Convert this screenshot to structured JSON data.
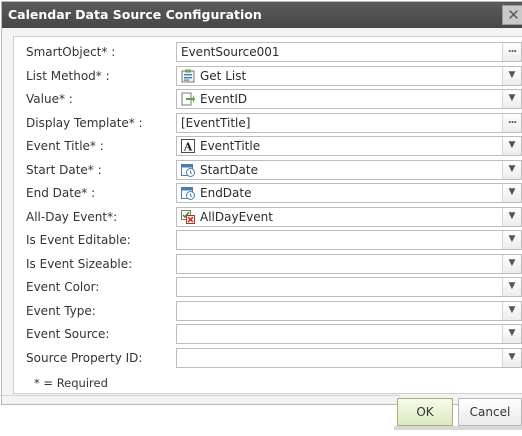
{
  "dialog": {
    "title": "Calendar Data Source Configuration",
    "close_glyph": "✕"
  },
  "fields": [
    {
      "label": "SmartObject* :",
      "value": "EventSource001",
      "icon": "",
      "button": "ellipsis"
    },
    {
      "label": "List Method* :",
      "value": "Get List",
      "icon": "list-method-icon",
      "button": "dropdown"
    },
    {
      "label": "Value* :",
      "value": "EventID",
      "icon": "id-property-icon",
      "button": "dropdown"
    },
    {
      "label": "Display Template* :",
      "value": "[EventTitle]",
      "icon": "",
      "button": "ellipsis"
    },
    {
      "label": "Event Title* :",
      "value": "EventTitle",
      "icon": "text-property-icon",
      "button": "dropdown"
    },
    {
      "label": "Start Date* :",
      "value": "StartDate",
      "icon": "datetime-property-icon",
      "button": "dropdown"
    },
    {
      "label": "End Date* :",
      "value": "EndDate",
      "icon": "datetime-property-icon",
      "button": "dropdown"
    },
    {
      "label": "All-Day Event*:",
      "value": "AllDayEvent",
      "icon": "boolean-property-icon",
      "button": "dropdown"
    },
    {
      "label": "Is Event Editable:",
      "value": "",
      "icon": "",
      "button": "dropdown"
    },
    {
      "label": "Is Event Sizeable:",
      "value": "",
      "icon": "",
      "button": "dropdown"
    },
    {
      "label": "Event Color:",
      "value": "",
      "icon": "",
      "button": "dropdown"
    },
    {
      "label": "Event Type:",
      "value": "",
      "icon": "",
      "button": "dropdown"
    },
    {
      "label": "Event Source:",
      "value": "",
      "icon": "",
      "button": "dropdown"
    },
    {
      "label": "Source Property ID:",
      "value": "",
      "icon": "",
      "button": "dropdown"
    }
  ],
  "required_note": "* = Required",
  "buttons": {
    "ok": "OK",
    "cancel": "Cancel"
  },
  "glyphs": {
    "dropdown": "▼",
    "ellipsis": "..."
  },
  "colors": {
    "titlebar": "#4f4f4f",
    "ok_button": "#dbe9c1"
  }
}
